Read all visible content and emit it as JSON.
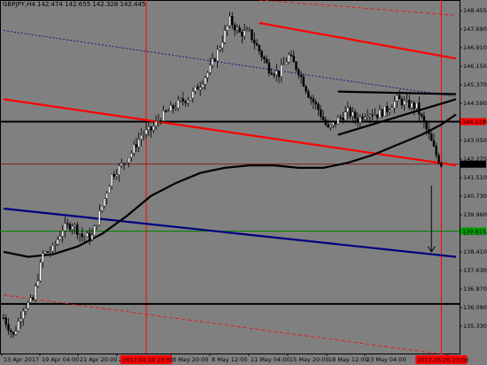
{
  "window": {
    "title": "GBPJPY,H4  142.474 142.655 142.328 142.445"
  },
  "colors": {
    "background": "#808080",
    "bull_candle": "#ffffff",
    "bear_candle": "#000000",
    "trend_red": "#ff0000",
    "trend_blue": "#000080",
    "level_green": "#008000",
    "ma_black": "#000000",
    "price_label_red": "#ff0000",
    "price_label_green": "#00a000",
    "current_price_label": "#000000",
    "time_marker": "#ff0000"
  },
  "price_axis": {
    "labels": [
      "148.455",
      "147.690",
      "146.910",
      "146.150",
      "145.370",
      "144.590",
      "143.830",
      "143.050",
      "142.275",
      "141.510",
      "140.730",
      "139.960",
      "139.180",
      "138.410",
      "137.630",
      "136.870",
      "136.090",
      "135.330"
    ],
    "highlighted": [
      {
        "text": "144.118",
        "role": "horizontal-level",
        "color": "#ff0000"
      },
      {
        "text": "142.445",
        "role": "current-price",
        "color": "#000000"
      },
      {
        "text": "139.815",
        "role": "green-level",
        "color": "#00a000"
      }
    ]
  },
  "time_axis": {
    "labels": [
      "13 Apr 2017",
      "19 Apr 04:00",
      "21 Apr 20:00",
      "26",
      "3 May 20:00",
      "8 May 12:00",
      "11 May 04:00",
      "15 May 20:00",
      "18 May 12:00",
      "23 May 04:00"
    ],
    "highlighted": [
      {
        "text": "2017.04.28 23:00",
        "color": "#ff0000"
      },
      {
        "text": "2017.05.26 23:00",
        "color": "#ff0000"
      }
    ]
  },
  "chart_data": {
    "type": "candlestick",
    "symbol": "GBPJPY",
    "timeframe": "H4",
    "last_ohlc": {
      "open": 142.474,
      "high": 142.655,
      "low": 142.328,
      "close": 142.445
    },
    "ylim": [
      135.0,
      148.9
    ],
    "close_path": [
      [
        0,
        136.4
      ],
      [
        4,
        135.7
      ],
      [
        8,
        136.8
      ],
      [
        12,
        137.1
      ],
      [
        16,
        138.9
      ],
      [
        20,
        139.1
      ],
      [
        24,
        139.9
      ],
      [
        28,
        140.1
      ],
      [
        32,
        139.6
      ],
      [
        36,
        139.6
      ],
      [
        40,
        140.8
      ],
      [
        44,
        142.0
      ],
      [
        48,
        142.4
      ],
      [
        52,
        142.9
      ],
      [
        56,
        143.6
      ],
      [
        60,
        143.8
      ],
      [
        64,
        144.3
      ],
      [
        68,
        144.6
      ],
      [
        72,
        144.9
      ],
      [
        76,
        145.1
      ],
      [
        80,
        145.6
      ],
      [
        84,
        146.2
      ],
      [
        88,
        147.1
      ],
      [
        92,
        148.1
      ],
      [
        96,
        147.6
      ],
      [
        100,
        147.6
      ],
      [
        104,
        146.9
      ],
      [
        108,
        146.2
      ],
      [
        112,
        146.0
      ],
      [
        116,
        146.7
      ],
      [
        120,
        146.1
      ],
      [
        124,
        145.2
      ],
      [
        128,
        144.6
      ],
      [
        132,
        143.8
      ],
      [
        136,
        144.2
      ],
      [
        140,
        144.5
      ],
      [
        144,
        144.2
      ],
      [
        148,
        144.5
      ],
      [
        152,
        144.4
      ],
      [
        156,
        144.6
      ],
      [
        160,
        145.0
      ],
      [
        164,
        144.8
      ],
      [
        168,
        144.7
      ],
      [
        172,
        143.8
      ],
      [
        176,
        142.8
      ],
      [
        178,
        142.445
      ]
    ],
    "ma_curve": [
      [
        0,
        139.0
      ],
      [
        10,
        138.8
      ],
      [
        20,
        138.9
      ],
      [
        30,
        139.2
      ],
      [
        40,
        139.7
      ],
      [
        50,
        140.4
      ],
      [
        60,
        141.2
      ],
      [
        70,
        141.7
      ],
      [
        80,
        142.1
      ],
      [
        90,
        142.3
      ],
      [
        100,
        142.4
      ],
      [
        110,
        142.4
      ],
      [
        120,
        142.3
      ],
      [
        130,
        142.3
      ],
      [
        140,
        142.5
      ],
      [
        150,
        142.8
      ],
      [
        160,
        143.2
      ],
      [
        170,
        143.6
      ],
      [
        178,
        144.0
      ],
      [
        184,
        144.4
      ]
    ],
    "horizontal_levels": [
      {
        "price": 144.118,
        "color": "black"
      },
      {
        "price": 142.445,
        "color": "red-thin"
      },
      {
        "price": 139.815,
        "color": "green"
      },
      {
        "price": 136.95,
        "color": "black"
      }
    ],
    "trendlines": [
      {
        "from": [
          0,
          145.0
        ],
        "to": [
          184,
          142.4
        ],
        "color": "red",
        "width": "thick"
      },
      {
        "from": [
          104,
          148.0
        ],
        "to": [
          184,
          146.6
        ],
        "color": "red",
        "width": "thick"
      },
      {
        "from": [
          0,
          140.7
        ],
        "to": [
          184,
          138.8
        ],
        "color": "navy",
        "width": "thick"
      },
      {
        "from": [
          0,
          147.7
        ],
        "to": [
          184,
          145.1
        ],
        "color": "navy",
        "width": "dotted"
      },
      {
        "from": [
          0,
          137.3
        ],
        "to": [
          184,
          134.9
        ],
        "color": "red",
        "width": "dashed"
      },
      {
        "from": [
          136,
          145.3
        ],
        "to": [
          184,
          145.2
        ],
        "color": "black",
        "width": "thick"
      },
      {
        "from": [
          136,
          143.6
        ],
        "to": [
          184,
          145.0
        ],
        "color": "black",
        "width": "thick"
      },
      {
        "from": [
          104,
          148.9
        ],
        "to": [
          184,
          148.3
        ],
        "color": "red",
        "width": "dashed-thin"
      }
    ],
    "vertical_markers": [
      {
        "label": "2017.04.28 23:00",
        "x": 58
      },
      {
        "label": "2017.05.26 23:00",
        "x": 178
      }
    ],
    "projection_arrow": {
      "from": [
        174,
        141.6
      ],
      "to": [
        174,
        139.0
      ],
      "color": "black"
    }
  }
}
